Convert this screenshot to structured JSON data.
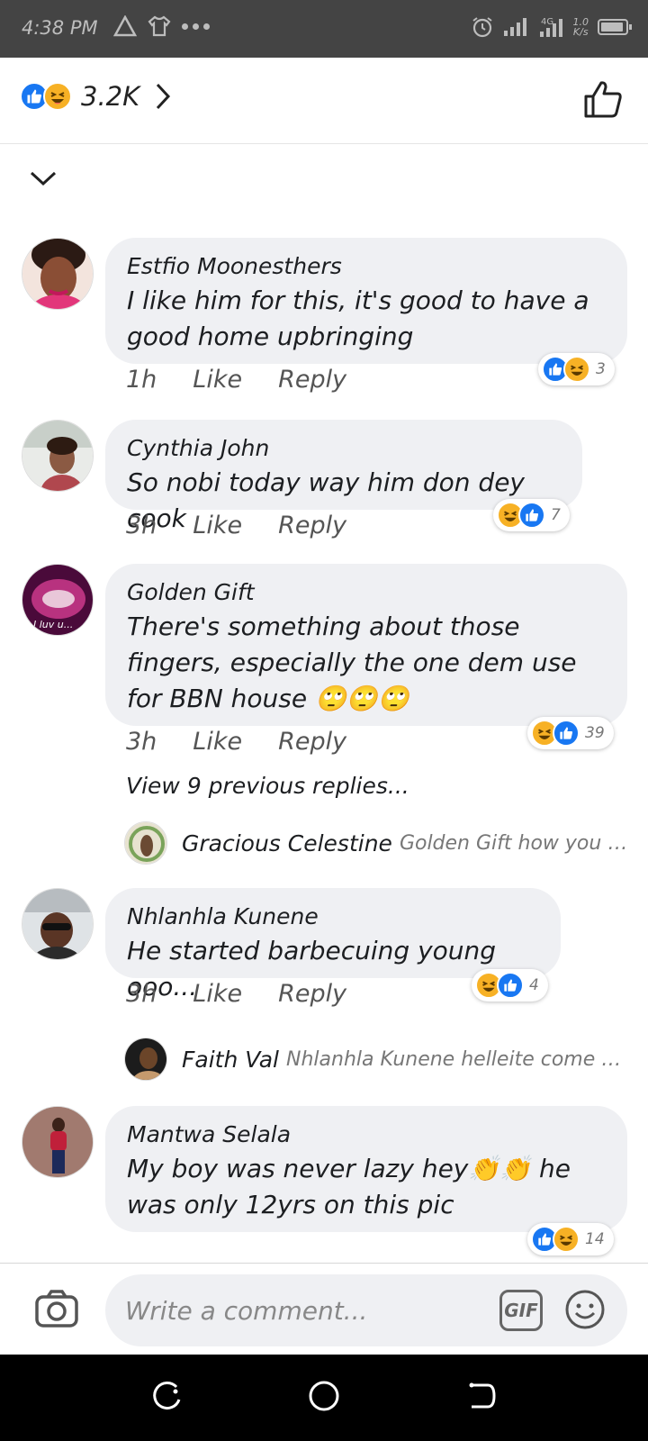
{
  "status_bar": {
    "time": "4:38 PM",
    "net_speed_value": "1.0",
    "net_speed_unit": "K/s",
    "network": "4G"
  },
  "header": {
    "reaction_count": "3.2K",
    "reactions": [
      "like-icon",
      "haha-icon"
    ]
  },
  "comments": [
    {
      "author": "Estfio Moonesthers",
      "text": "I like him for this, it's good to have a good home upbringing",
      "time": "1h",
      "like_label": "Like",
      "reply_label": "Reply",
      "reaction_count": "3",
      "reactions": [
        "like",
        "haha"
      ]
    },
    {
      "author": "Cynthia John",
      "text": "So nobi today way him don dey cook",
      "time": "3h",
      "like_label": "Like",
      "reply_label": "Reply",
      "reaction_count": "7",
      "reactions": [
        "haha",
        "like"
      ]
    },
    {
      "author": "Golden Gift",
      "text": "There's something about those fingers, especially the one dem use for BBN house 🙄🙄🙄",
      "time": "3h",
      "like_label": "Like",
      "reply_label": "Reply",
      "reaction_count": "39",
      "reactions": [
        "haha",
        "like"
      ],
      "avatar_text": "I luv u...",
      "view_previous": "View 9 previous replies...",
      "reply": {
        "author": "Gracious Celestine",
        "text": "Golden Gift how you wi..."
      }
    },
    {
      "author": "Nhlanhla Kunene",
      "text": "He started barbecuing young ooo...",
      "time": "3h",
      "like_label": "Like",
      "reply_label": "Reply",
      "reaction_count": "4",
      "reactions": [
        "haha",
        "like"
      ],
      "reply": {
        "author": "Faith Val",
        "text": "Nhlanhla Kunene helleite come se..."
      }
    },
    {
      "author": "Mantwa Selala",
      "text": "My boy was never lazy hey👏👏 he was only 12yrs on this pic",
      "reaction_count": "14",
      "reactions": [
        "like",
        "haha"
      ]
    }
  ],
  "composer": {
    "placeholder": "Write a comment...",
    "gif_label": "GIF"
  },
  "colors": {
    "like_blue": "#1877f2",
    "haha_yellow": "#f7b125",
    "bubble_gray": "#eff0f3",
    "status_bar": "#444444",
    "nav_bar": "#000000"
  }
}
